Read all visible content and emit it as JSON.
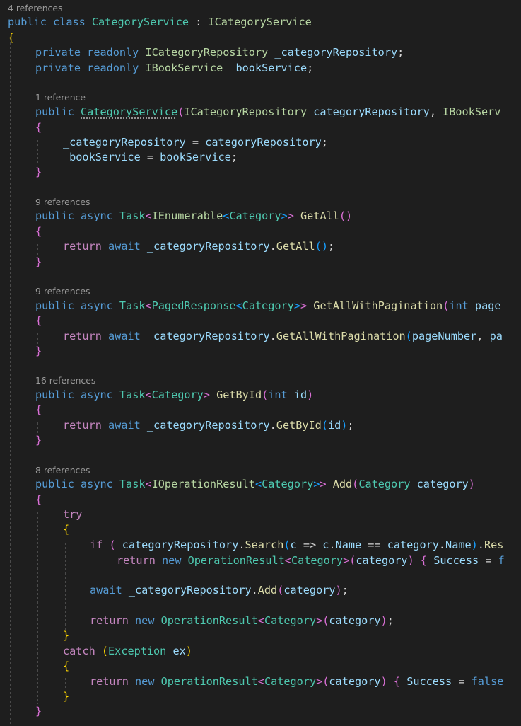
{
  "editor": {
    "language": "csharp",
    "codelens": {
      "class": "4 references",
      "ctor": "1 reference",
      "getall": "9 references",
      "getallpaged": "9 references",
      "getbyid": "16 references",
      "add": "8 references"
    }
  },
  "colors": {
    "background": "#1e1e1e",
    "keyword": "#569cd6",
    "control_keyword": "#c586c0",
    "type": "#4ec9b0",
    "interface": "#b8d7a3",
    "method": "#dcdcaa",
    "identifier": "#9cdcfe",
    "text": "#d4d4d4",
    "bracket_level1": "#ffd700",
    "bracket_level2": "#da70d6",
    "bracket_level3": "#179fff",
    "codelens": "#9a9a9a"
  },
  "t": {
    "public": "public",
    "private": "private",
    "readonly": "readonly",
    "class": "class",
    "async": "async",
    "return": "return",
    "await": "await",
    "int": "int",
    "try": "try",
    "catch": "catch",
    "if": "if",
    "new": "new",
    "false": "false",
    "Task": "Task",
    "IEnumerable": "IEnumerable",
    "Category": "Category",
    "PagedResponse": "PagedResponse",
    "IOperationResult": "IOperationResult",
    "OperationResult": "OperationResult",
    "Exception": "Exception",
    "ICategoryRepository": "ICategoryRepository",
    "IBookService": "IBookService",
    "ICategoryService": "ICategoryService",
    "CategoryService": "CategoryService",
    "IBookServ": "IBookServ",
    "_categoryRepository": "_categoryRepository",
    "_bookService": "_bookService",
    "categoryRepository": "categoryRepository",
    "bookService": "bookService",
    "category": "category",
    "pageNumber": "pageNumber",
    "page": "page",
    "pa": "pa",
    "id": "id",
    "ex": "ex",
    "c": "c",
    "Name": "Name",
    "Success": "Success",
    "f": "f",
    "Res": "Res",
    "GetAll": "GetAll",
    "GetAllWithPagination": "GetAllWithPagination",
    "GetById": "GetById",
    "Add": "Add",
    "Search": "Search",
    "colon": " : ",
    "comma": ", ",
    "semi": ";",
    "dot": ".",
    "assign": " = ",
    "eqeq": " == ",
    "arrow": " => ",
    "lt": "<",
    "gt": ">",
    "gtgt": ">>",
    "lbrace": "{",
    "rbrace": "}",
    "lparen": "(",
    "rparen": ")",
    "sp": " "
  }
}
